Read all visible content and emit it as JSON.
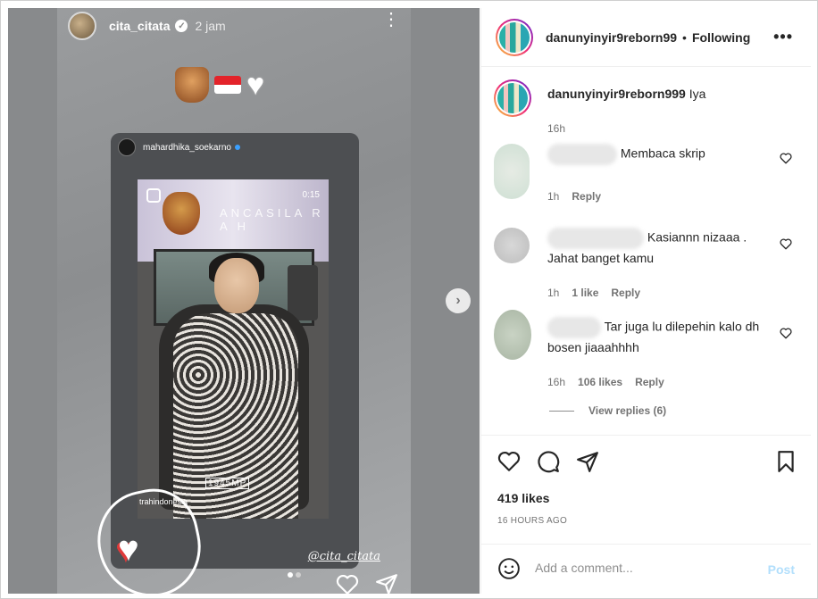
{
  "story": {
    "username": "cita_citata",
    "time": "2 jam",
    "repost_username": "mahardhika_soekarno",
    "video_duration": "0:15",
    "video_banner": "ANCASILA  R A H",
    "video_watermark": "1945MP",
    "tag": "trahindonesia",
    "mention": "@cita_citata",
    "page_count": 2,
    "active_page": 1
  },
  "post": {
    "header": {
      "username": "danunyinyir9reborn99",
      "separator": "•",
      "following_label": "Following",
      "more_label": "•••"
    },
    "caption": {
      "username": "danunyinyir9reborn999",
      "text": "Iya",
      "time": "16h"
    },
    "comments": [
      {
        "text": "Membaca skrip",
        "time": "1h",
        "likes": "",
        "reply_label": "Reply"
      },
      {
        "text": "Kasiannn nizaaa . Jahat banget kamu",
        "time": "1h",
        "likes": "1 like",
        "reply_label": "Reply"
      },
      {
        "text": "Tar juga lu dilepehin kalo dh bosen jiaaahhhh",
        "time": "16h",
        "likes": "106 likes",
        "reply_label": "Reply"
      }
    ],
    "view_replies": "View replies (6)",
    "likes": "419 likes",
    "timestamp": "16 HOURS AGO",
    "comment_placeholder": "Add a comment...",
    "post_label": "Post"
  },
  "colors": {
    "accent": "#0095f6",
    "post_disabled": "#b2dffc",
    "text": "#262626",
    "muted": "#737373"
  },
  "icons": {
    "like": "heart-icon",
    "comment": "comment-icon",
    "share": "paper-plane-icon",
    "save": "bookmark-icon",
    "emoji": "emoji-icon",
    "next": "chevron-right-icon"
  }
}
